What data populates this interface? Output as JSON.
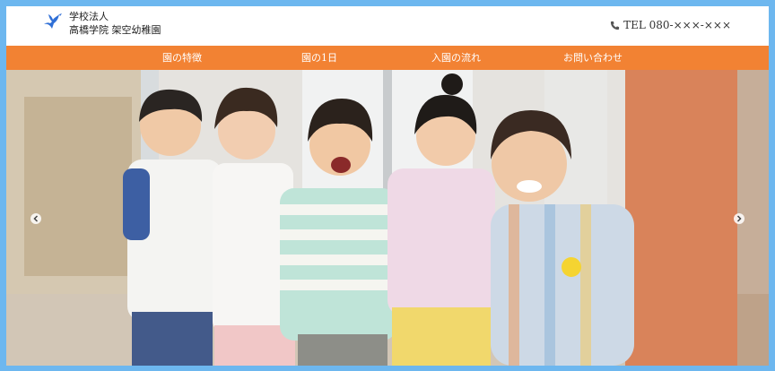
{
  "header": {
    "school_type": "学校法人",
    "school_name": "高橋学院 架空幼稚園",
    "phone": "TEL 080-×××-×××",
    "logo_icon": "bird-logo-icon",
    "phone_icon": "phone-icon"
  },
  "nav": {
    "items": [
      {
        "label": "園の特徴"
      },
      {
        "label": "園の1日"
      },
      {
        "label": "入園の流れ"
      },
      {
        "label": "お問い合わせ"
      }
    ]
  },
  "hero": {
    "prev_icon": "chevron-left-icon",
    "next_icon": "chevron-right-icon",
    "image": "photo of four children and a smiling teacher"
  },
  "colors": {
    "nav_bg": "#f28233",
    "frame": "#6db7ef",
    "logo": "#2f6fd6"
  }
}
